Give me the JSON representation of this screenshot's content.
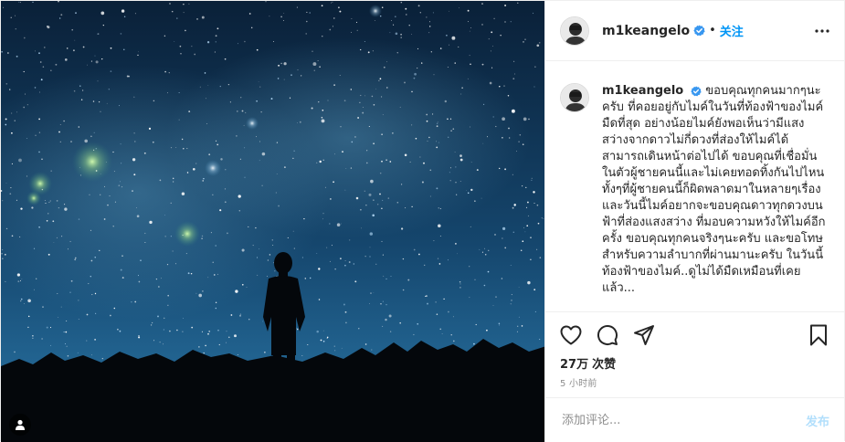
{
  "post": {
    "image_alt": "Silhouette under a starry night sky",
    "colors": {
      "sky_top": "#0b2340",
      "sky_bottom": "#1d5d8c",
      "ground": "#05080c",
      "accent_blue": "#0095f6",
      "verified_blue": "#3897f0"
    }
  },
  "header": {
    "username": "m1keangelo",
    "separator": "•",
    "follow_label": "关注",
    "more_icon": "more-horizontal-icon"
  },
  "caption": {
    "username": "m1keangelo",
    "text": "ขอบคุณทุกคนมากๆนะครับ ที่คอยอยู่กับไมค์ในวันที่ท้องฟ้าของไมค์มืดที่สุด อย่างน้อยไมค์ยังพอเห็นว่ามีแสงสว่างจากดาวไม่กี่ดวงที่ส่องให้ไมค์ได้สามารถเดินหน้าต่อไปได้ ขอบคุณที่เชื่อมั่นในตัวผู้ชายคนนี้และไม่เคยทอดทิ้งกันไปไหน ทั้งๆที่ผู้ชายคนนี้ก็ผิดพลาดมาในหลายๆเรื่อง และวันนี้ไมค์อยากจะขอบคุณดาวทุกดวงบนฟ้าที่ส่องแสงสว่าง ที่มอบความหวังให้ไมค์อีกครั้ง ขอบคุณทุกคนจริงๆนะครับ และขอโทษสำหรับความลำบากที่ผ่านมานะครับ ในวันนี้ท้องฟ้าของไมค์..ดูไม่ได้มืดเหมือนที่เคยแล้ว..."
  },
  "actions": {
    "like_icon": "heart-icon",
    "comment_icon": "comment-icon",
    "share_icon": "share-icon",
    "save_icon": "bookmark-icon"
  },
  "stats": {
    "likes_count": "27万",
    "likes_label": "次赞",
    "time_ago": "5 小时前"
  },
  "comment": {
    "placeholder": "添加评论...",
    "post_label": "发布"
  }
}
